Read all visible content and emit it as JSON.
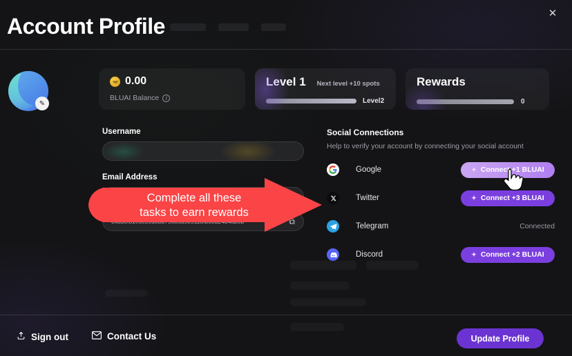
{
  "window": {
    "title": "Account Profile",
    "close_icon": "close-icon"
  },
  "profile": {
    "avatar_edit_icon": "pencil-icon"
  },
  "stats": {
    "balance": {
      "coin_icon": "coin-icon",
      "amount": "0.00",
      "label": "BLUAI Balance",
      "info_icon": "info-icon",
      "info_glyph": "i"
    },
    "level": {
      "title": "Level 1",
      "next_level_text": "Next level +10 spots",
      "next_level_label": "Level2",
      "progress_percent": 0
    },
    "rewards": {
      "title": "Rewards",
      "count": "0",
      "progress_percent": 0
    }
  },
  "form": {
    "username_label": "Username",
    "username_value": "",
    "username_placeholder": "",
    "email_label": "Email Address",
    "email_value": "",
    "email_placeholder": "",
    "wallet_address": "0xa33f31e8c39d0bb75685d505118fb38d24b4ab0b",
    "copy_icon": "copy-icon",
    "copy_glyph": "⧉"
  },
  "social": {
    "title": "Social Connections",
    "subtitle": "Help to verify your account by connecting your social account",
    "connections": [
      {
        "name": "Google",
        "icon": "google-icon",
        "glyph": "G",
        "action_label": "Connect +1 BLUAI",
        "state": "disconnected",
        "hovered": true
      },
      {
        "name": "Twitter",
        "icon": "x-twitter-icon",
        "glyph": "𝕏",
        "action_label": "Connect +3 BLUAI",
        "state": "disconnected",
        "hovered": false
      },
      {
        "name": "Telegram",
        "icon": "telegram-icon",
        "glyph": "➤",
        "action_label": "Connected",
        "state": "connected",
        "hovered": false
      },
      {
        "name": "Discord",
        "icon": "discord-icon",
        "glyph": "●●",
        "action_label": "Connect +2 BLUAI",
        "state": "disconnected",
        "hovered": false
      }
    ],
    "spark_glyph": "✦"
  },
  "footer": {
    "sign_out_label": "Sign out",
    "sign_out_icon": "upload-icon",
    "sign_out_glyph": "⇧",
    "contact_label": "Contact Us",
    "contact_icon": "envelope-icon",
    "contact_glyph": "✉",
    "update_label": "Update Profile"
  },
  "annotation": {
    "line1": "Complete all these",
    "line2": "tasks to earn rewards",
    "color": "#fa4446",
    "shape": "right-arrow"
  },
  "colors": {
    "accent_purple": "#6b33d1",
    "connect_purple": "#7b3fe0",
    "annotation_red": "#fa4446",
    "background": "#141416"
  },
  "cursor": {
    "icon": "pointer-hand-cursor"
  }
}
